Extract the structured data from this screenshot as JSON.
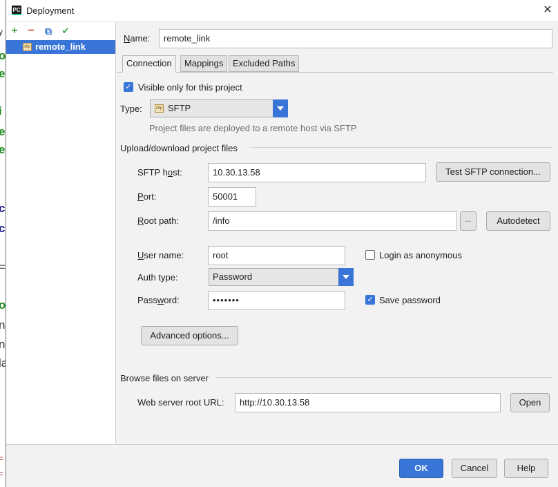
{
  "window": {
    "title": "Deployment",
    "app_icon": "PC",
    "close_glyph": "✕"
  },
  "toolbar": {
    "add_glyph": "+",
    "remove_glyph": "−",
    "copy_glyph": "⧉",
    "default_glyph": "✔"
  },
  "servers": [
    {
      "label": "remote_link",
      "icon_text": "sftp"
    }
  ],
  "name": {
    "label": "Name:",
    "value": "remote_link"
  },
  "tabs": [
    {
      "label": "Connection"
    },
    {
      "label": "Mappings"
    },
    {
      "label": "Excluded Paths"
    }
  ],
  "connection": {
    "visible_only": {
      "label": "Visible only for this project",
      "checked": true
    },
    "type": {
      "label": "Type:",
      "value": "SFTP",
      "icon_text": "sftp",
      "description": "Project files are deployed to a remote host via SFTP"
    },
    "upload_section": {
      "title": "Upload/download project files"
    },
    "sftp_host": {
      "label": "SFTP host:",
      "value": "10.30.13.58"
    },
    "test_button": "Test SFTP connection...",
    "port": {
      "label": "Port:",
      "value": "50001"
    },
    "root_path": {
      "label": "Root path:",
      "value": "/info",
      "browse": "..."
    },
    "autodetect_button": "Autodetect",
    "user_name": {
      "label": "User name:",
      "value": "root"
    },
    "login_anonymous": {
      "label": "Login as anonymous",
      "checked": false
    },
    "auth_type": {
      "label": "Auth type:",
      "value": "Password"
    },
    "password": {
      "label": "Password:",
      "value": "•••••••"
    },
    "save_password": {
      "label": "Save password",
      "checked": true
    },
    "advanced_button": "Advanced options...",
    "browse_section": {
      "title": "Browse files on server"
    },
    "web_root": {
      "label": "Web server root URL:",
      "value": "http://10.30.13.58"
    },
    "open_button": "Open"
  },
  "footer": {
    "ok": "OK",
    "cancel": "Cancel",
    "help": "Help"
  },
  "colors": {
    "accent": "#3875d7",
    "add": "#3fa83f",
    "remove": "#d94a3a"
  }
}
